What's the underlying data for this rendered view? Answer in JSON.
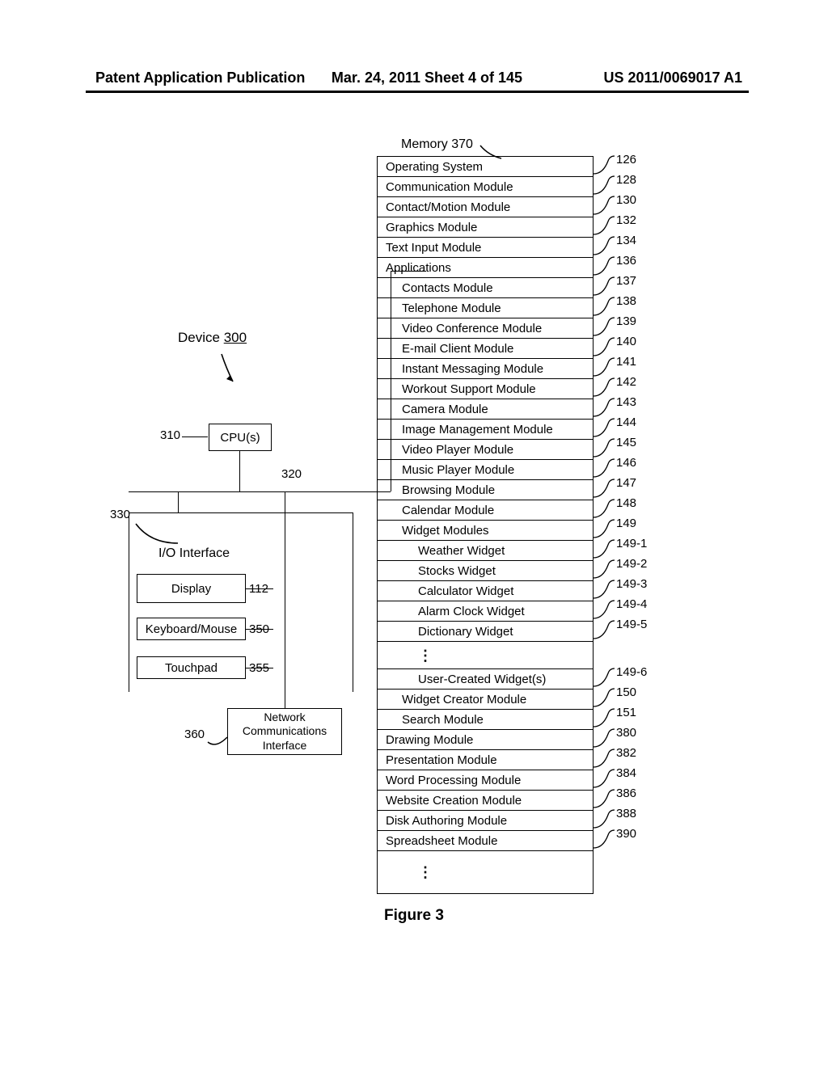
{
  "header": {
    "left": "Patent Application Publication",
    "mid": "Mar. 24, 2011 Sheet 4 of 145",
    "right": "US 2011/0069017 A1"
  },
  "left_diagram": {
    "device_label": "Device",
    "device_num": "300",
    "cpu": "CPU(s)",
    "cpu_ref": "310",
    "bus_ref": "320",
    "io_ref": "330",
    "io_title": "I/O Interface",
    "display": "Display",
    "display_ref": "112",
    "kbd": "Keyboard/Mouse",
    "kbd_ref": "350",
    "tpad": "Touchpad",
    "tpad_ref": "355",
    "net": "Network\nCommunications\nInterface",
    "net_ref": "360"
  },
  "memory_label": "Memory 370",
  "memory_rows": [
    {
      "text": "Operating System",
      "indent": 0,
      "ref": "126"
    },
    {
      "text": "Communication Module",
      "indent": 0,
      "ref": "128"
    },
    {
      "text": "Contact/Motion Module",
      "indent": 0,
      "ref": "130"
    },
    {
      "text": "Graphics Module",
      "indent": 0,
      "ref": "132"
    },
    {
      "text": "Text Input Module",
      "indent": 0,
      "ref": "134"
    },
    {
      "text": "Applications",
      "indent": 0,
      "ref": "136"
    },
    {
      "text": "Contacts Module",
      "indent": 1,
      "ref": "137"
    },
    {
      "text": "Telephone Module",
      "indent": 1,
      "ref": "138"
    },
    {
      "text": "Video Conference Module",
      "indent": 1,
      "ref": "139"
    },
    {
      "text": "E-mail Client Module",
      "indent": 1,
      "ref": "140"
    },
    {
      "text": "Instant Messaging Module",
      "indent": 1,
      "ref": "141"
    },
    {
      "text": "Workout Support Module",
      "indent": 1,
      "ref": "142"
    },
    {
      "text": "Camera Module",
      "indent": 1,
      "ref": "143"
    },
    {
      "text": "Image Management Module",
      "indent": 1,
      "ref": "144"
    },
    {
      "text": "Video Player Module",
      "indent": 1,
      "ref": "145"
    },
    {
      "text": "Music Player Module",
      "indent": 1,
      "ref": "146"
    },
    {
      "text": "Browsing Module",
      "indent": 1,
      "ref": "147"
    },
    {
      "text": "Calendar Module",
      "indent": 1,
      "ref": "148"
    },
    {
      "text": "Widget Modules",
      "indent": 1,
      "ref": "149"
    },
    {
      "text": "Weather Widget",
      "indent": 2,
      "ref": "149-1"
    },
    {
      "text": "Stocks Widget",
      "indent": 2,
      "ref": "149-2"
    },
    {
      "text": "Calculator Widget",
      "indent": 2,
      "ref": "149-3"
    },
    {
      "text": "Alarm Clock Widget",
      "indent": 2,
      "ref": "149-4"
    },
    {
      "text": "Dictionary Widget",
      "indent": 2,
      "ref": "149-5"
    },
    {
      "text": "⋮",
      "indent": "dots",
      "ref": ""
    },
    {
      "text": "User-Created Widget(s)",
      "indent": 2,
      "ref": "149-6"
    },
    {
      "text": "Widget Creator Module",
      "indent": 1,
      "ref": "150"
    },
    {
      "text": "Search Module",
      "indent": 1,
      "ref": "151"
    },
    {
      "text": "Drawing Module",
      "indent": 0,
      "ref": "380"
    },
    {
      "text": "Presentation Module",
      "indent": 0,
      "ref": "382"
    },
    {
      "text": "Word Processing  Module",
      "indent": 0,
      "ref": "384"
    },
    {
      "text": "Website Creation Module",
      "indent": 0,
      "ref": "386"
    },
    {
      "text": "Disk Authoring Module",
      "indent": 0,
      "ref": "388"
    },
    {
      "text": "Spreadsheet Module",
      "indent": 0,
      "ref": "390"
    },
    {
      "text": "⋮",
      "indent": "dots2",
      "ref": ""
    }
  ],
  "figure_caption": "Figure 3"
}
